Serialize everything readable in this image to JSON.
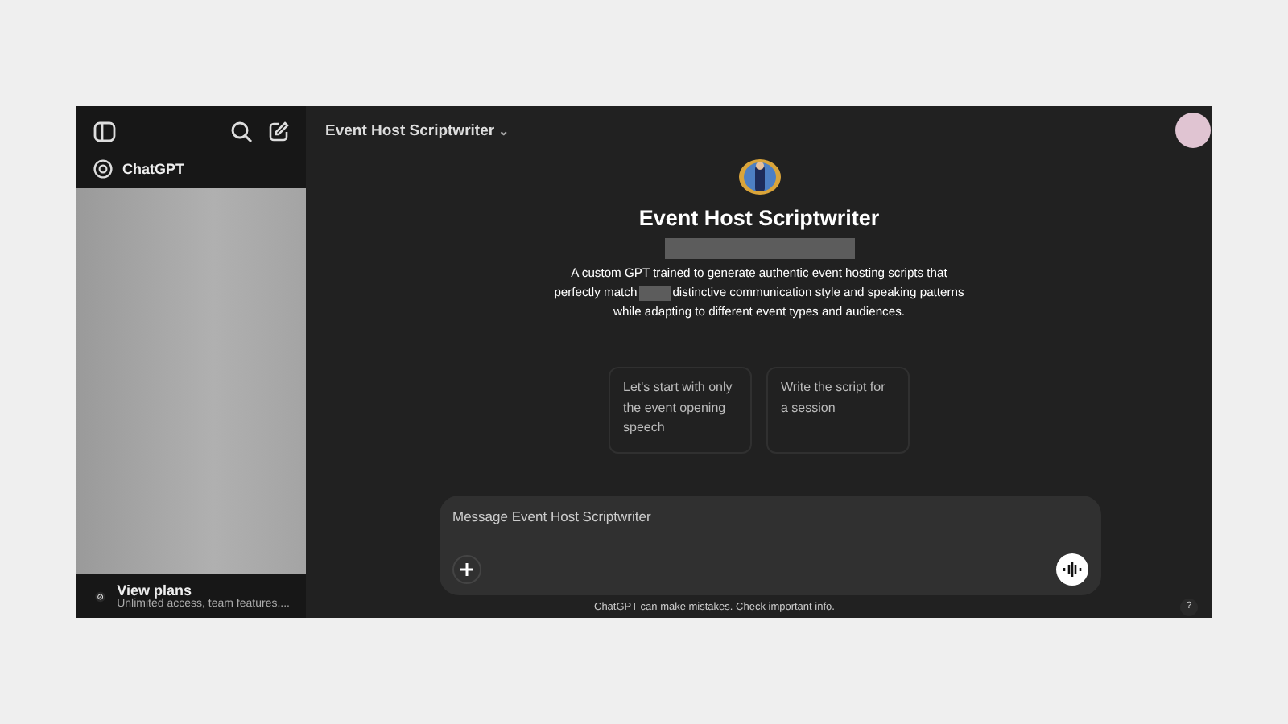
{
  "sidebar": {
    "top_item": "ChatGPT",
    "footer": {
      "title": "View plans",
      "subtitle": "Unlimited access, team features,..."
    }
  },
  "header": {
    "title": "Event Host Scriptwriter",
    "caret": "⌄"
  },
  "gpt": {
    "name": "Event Host Scriptwriter",
    "description_parts": [
      "A custom GPT trained to generate authentic event hosting scripts that perfectly match",
      "distinctive communication style and speaking patterns while adapting to different event types and audiences."
    ]
  },
  "suggestions": [
    "Let's start with only the event opening speech",
    "Write the script for a session"
  ],
  "composer": {
    "placeholder": "Message Event Host Scriptwriter"
  },
  "disclaimer": "ChatGPT can make mistakes. Check important info.",
  "help": "?"
}
